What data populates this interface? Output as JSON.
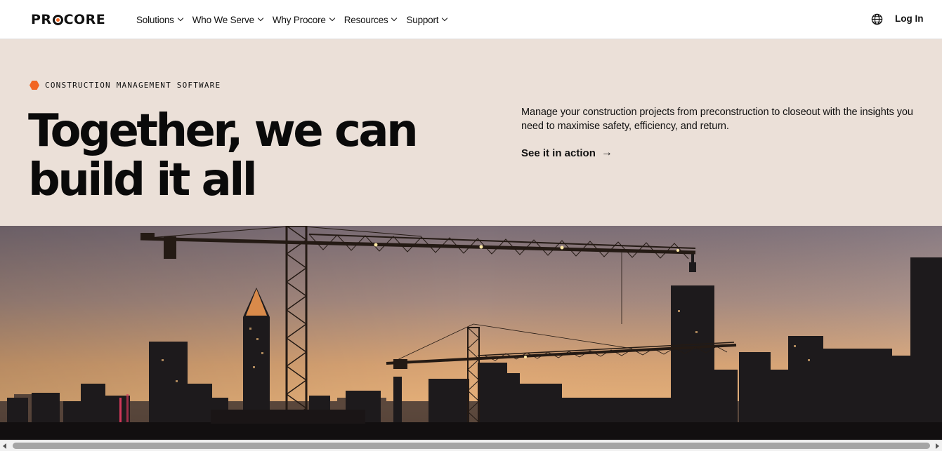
{
  "header": {
    "logo_pre": "PR",
    "logo_post": "CORE",
    "nav": [
      {
        "label": "Solutions"
      },
      {
        "label": "Who We Serve"
      },
      {
        "label": "Why Procore"
      },
      {
        "label": "Resources"
      },
      {
        "label": "Support"
      }
    ],
    "login_label": "Log In",
    "globe_icon": "globe-icon"
  },
  "hero": {
    "eyebrow": "CONSTRUCTION MANAGEMENT SOFTWARE",
    "headline_line1": "Together, we can",
    "headline_line2": "build it all",
    "subtext": "Manage your construction projects from preconstruction to closeout with the insights you need to maximise safety, efficiency, and return.",
    "cta_label": "See it in action",
    "cta_icon": "arrow-right-icon"
  },
  "colors": {
    "accent": "#f26522",
    "hero_bg": "#ebe0d8",
    "text": "#111111"
  }
}
